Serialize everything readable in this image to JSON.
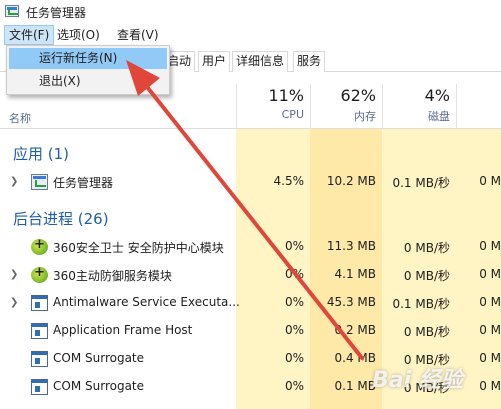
{
  "window": {
    "title": "任务管理器",
    "icon": "task-manager-icon"
  },
  "menubar": {
    "items": [
      "文件(F)",
      "选项(O)",
      "查看(V)"
    ]
  },
  "dropdown": {
    "items": [
      "运行新任务(N)",
      "退出(X)"
    ]
  },
  "tabs": [
    "启动",
    "用户",
    "详细信息",
    "服务"
  ],
  "columns": {
    "name_label": "名称",
    "cpu": {
      "percent": "11%",
      "label": "CPU"
    },
    "memory": {
      "percent": "62%",
      "label": "内存"
    },
    "disk": {
      "percent": "4%",
      "label": "磁盘"
    }
  },
  "groups": {
    "apps": "应用 (1)",
    "background": "后台进程 (26)"
  },
  "apps": [
    {
      "name": "任务管理器",
      "cpu": "4.5%",
      "memory": "10.2 MB",
      "disk": "0.1 MB/秒",
      "network": "0 M",
      "icon": "task-manager-icon"
    }
  ],
  "processes": [
    {
      "name": "360安全卫士 安全防护中心模块",
      "cpu": "0%",
      "memory": "11.3 MB",
      "disk": "0 MB/秒",
      "network": "0 M",
      "icon": "360-icon"
    },
    {
      "name": "360主动防御服务模块",
      "cpu": "0%",
      "memory": "4.1 MB",
      "disk": "0 MB/秒",
      "network": "0 M",
      "icon": "360-icon"
    },
    {
      "name": "Antimalware Service Executa...",
      "cpu": "0%",
      "memory": "45.3 MB",
      "disk": "0.1 MB/秒",
      "network": "0 M",
      "icon": "service-icon"
    },
    {
      "name": "Application Frame Host",
      "cpu": "0%",
      "memory": "0.2 MB",
      "disk": "0 MB/秒",
      "network": "0 M",
      "icon": "app-frame-icon"
    },
    {
      "name": "COM Surrogate",
      "cpu": "0%",
      "memory": "0.4 MB",
      "disk": "0 MB/秒",
      "network": "0 M",
      "icon": "com-icon"
    },
    {
      "name": "COM Surrogate",
      "cpu": "0%",
      "memory": "0.1 MB",
      "disk": "0 MB/秒",
      "network": "0 M",
      "icon": "com-icon"
    }
  ],
  "watermark": "Bai 经验",
  "colors": {
    "heat_light": "#fff4c4",
    "heat_medium": "#ffe9a8",
    "arrow": "#e0463a",
    "group_text": "#1f5ea8",
    "menu_highlight": "#91c9f7"
  }
}
